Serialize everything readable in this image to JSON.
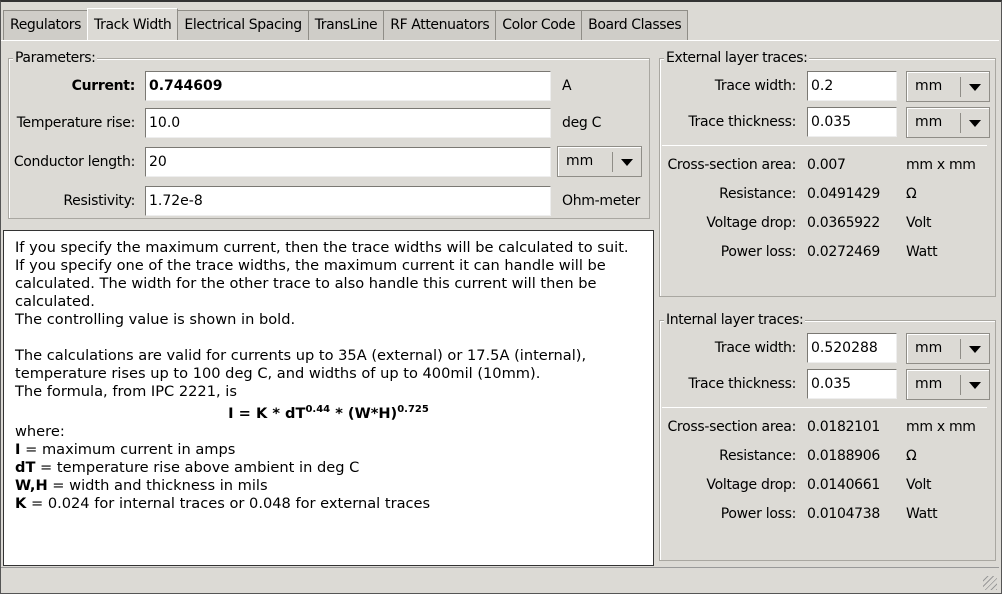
{
  "tabs": [
    "Regulators",
    "Track Width",
    "Electrical Spacing",
    "TransLine",
    "RF Attenuators",
    "Color Code",
    "Board Classes"
  ],
  "active_tab": "Track Width",
  "parameters": {
    "title": "Parameters:",
    "current": {
      "label": "Current:",
      "value": "0.744609",
      "unit": "A"
    },
    "temp_rise": {
      "label": "Temperature rise:",
      "value": "10.0",
      "unit": "deg C"
    },
    "length": {
      "label": "Conductor length:",
      "value": "20",
      "unit": "mm"
    },
    "resistivity": {
      "label": "Resistivity:",
      "value": "1.72e-8",
      "unit": "Ohm-meter"
    }
  },
  "help": {
    "lines": [
      "If you specify the maximum current, then the trace widths will be calculated to suit.",
      "If you specify one of the trace widths, the maximum current it can handle will be calculated. The width for the other trace to also handle this current will then be calculated.",
      "The controlling value is shown in bold.",
      "",
      "The calculations are valid for currents up to 35A (external) or 17.5A (internal), temperature rises up to 100 deg C, and widths of up to 400mil (10mm).",
      "The formula, from IPC 2221, is"
    ],
    "formula": {
      "a": "I = K * dT",
      "e1": "0.44",
      "b": " * (W*H)",
      "e2": "0.725"
    },
    "where": "where:",
    "defs": [
      {
        "k": "I",
        "d": " = maximum current in amps"
      },
      {
        "k": "dT",
        "d": " = temperature rise above ambient in deg C"
      },
      {
        "k": "W,H",
        "d": " = width and thickness in mils"
      },
      {
        "k": "K",
        "d": " = 0.024 for internal traces or 0.048 for external traces"
      }
    ]
  },
  "external": {
    "title": "External layer traces:",
    "width": {
      "label": "Trace width:",
      "value": "0.2",
      "unit": "mm"
    },
    "thickness": {
      "label": "Trace thickness:",
      "value": "0.035",
      "unit": "mm"
    },
    "results": [
      {
        "label": "Cross-section area:",
        "value": "0.007",
        "unit": "mm x mm"
      },
      {
        "label": "Resistance:",
        "value": "0.0491429",
        "unit": "Ω"
      },
      {
        "label": "Voltage drop:",
        "value": "0.0365922",
        "unit": "Volt"
      },
      {
        "label": "Power loss:",
        "value": "0.0272469",
        "unit": "Watt"
      }
    ]
  },
  "internal": {
    "title": "Internal layer traces:",
    "width": {
      "label": "Trace width:",
      "value": "0.520288",
      "unit": "mm"
    },
    "thickness": {
      "label": "Trace thickness:",
      "value": "0.035",
      "unit": "mm"
    },
    "results": [
      {
        "label": "Cross-section area:",
        "value": "0.0182101",
        "unit": "mm x mm"
      },
      {
        "label": "Resistance:",
        "value": "0.0188906",
        "unit": "Ω"
      },
      {
        "label": "Voltage drop:",
        "value": "0.0140661",
        "unit": "Volt"
      },
      {
        "label": "Power loss:",
        "value": "0.0104738",
        "unit": "Watt"
      }
    ]
  }
}
